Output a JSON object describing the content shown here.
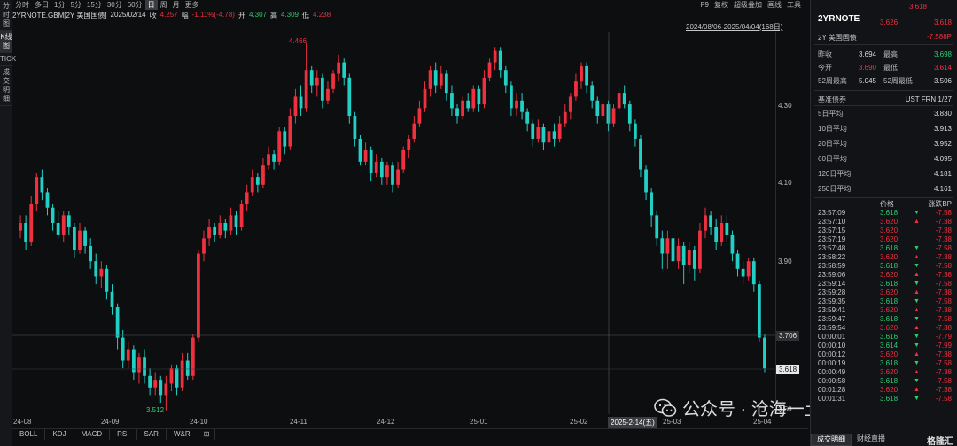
{
  "left_tabs": [
    "分时图",
    "K线图",
    "TICK",
    "成交明细"
  ],
  "left_tab_active": 1,
  "toolbar": {
    "periods": [
      "分时",
      "多日",
      "1分",
      "5分",
      "15分",
      "30分",
      "60分",
      "日",
      "周",
      "月",
      "更多"
    ],
    "active_period": 7,
    "right_items": [
      "F9",
      "复权",
      "超级叠加",
      "画线",
      "工具"
    ]
  },
  "info": {
    "symbol": "2YRNOTE.GBM[2Y 美国国债]",
    "date": "2025/02/14",
    "close_label": "收",
    "close": "4.257",
    "change_label": "幅",
    "change": "-1.11%(-4.78)",
    "open_label": "开",
    "open": "4.307",
    "high_label": "高",
    "high": "4.309",
    "low_label": "低",
    "low": "4.238"
  },
  "range_label": "2024/08/06-2025/04/04(168日)",
  "yaxis_ticks": [
    "4.30",
    "4.10",
    "3.90",
    "3.70",
    "3.50"
  ],
  "xaxis_ticks": [
    "24-08",
    "24-09",
    "24-10",
    "24-11",
    "24-12",
    "25-01",
    "25-02",
    "25-03",
    "25-04"
  ],
  "cursor_date": "2025-2-14(五)",
  "crosshair_price": "3.706",
  "last_price_tag": "3.618",
  "peak_high": "4.466",
  "trough_low": "3.512",
  "indicator_tabs": [
    "BOLL",
    "KDJ",
    "MACD",
    "RSI",
    "SAR",
    "W&R"
  ],
  "indicator_add": "⊞",
  "quote": {
    "symbol": "2YRNOTE",
    "name": "2Y 美国国债",
    "last_top": "3.618",
    "mid_a": "3.626",
    "mid_b": "3.618",
    "change_bp": "-7.588P",
    "stats": [
      {
        "l1": "昨收",
        "v1": "3.694",
        "c1": "white",
        "l2": "最高",
        "v2": "3.698",
        "c2": "green"
      },
      {
        "l1": "今开",
        "v1": "3.690",
        "c1": "up",
        "l2": "最低",
        "v2": "3.614",
        "c2": "up"
      },
      {
        "l1": "52周最高",
        "v1": "5.045",
        "c1": "white",
        "l2": "52周最低",
        "v2": "3.506",
        "c2": "white"
      }
    ],
    "benchmark_label": "基准债券",
    "benchmark_value": "UST FRN 1/27",
    "averages": [
      {
        "label": "5日平均",
        "value": "3.830"
      },
      {
        "label": "10日平均",
        "value": "3.913"
      },
      {
        "label": "20日平均",
        "value": "3.952"
      },
      {
        "label": "60日平均",
        "value": "4.095"
      },
      {
        "label": "120日平均",
        "value": "4.181"
      },
      {
        "label": "250日平均",
        "value": "4.161"
      }
    ],
    "trades_headers": [
      "价格",
      "涨跌BP"
    ],
    "trades": [
      {
        "t": "23:57:09",
        "p": "3.618",
        "d": "down",
        "bp": "-7.58"
      },
      {
        "t": "23:57:10",
        "p": "3.620",
        "d": "up",
        "bp": "-7.38"
      },
      {
        "t": "23:57:15",
        "p": "3.620",
        "d": "none",
        "bp": "-7.38"
      },
      {
        "t": "23:57:19",
        "p": "3.620",
        "d": "none",
        "bp": "-7.38"
      },
      {
        "t": "23:57:48",
        "p": "3.618",
        "d": "down",
        "bp": "-7.58"
      },
      {
        "t": "23:58:22",
        "p": "3.620",
        "d": "up",
        "bp": "-7.38"
      },
      {
        "t": "23:58:59",
        "p": "3.618",
        "d": "down",
        "bp": "-7.58"
      },
      {
        "t": "23:59:06",
        "p": "3.620",
        "d": "up",
        "bp": "-7.38"
      },
      {
        "t": "23:59:14",
        "p": "3.618",
        "d": "down",
        "bp": "-7.58"
      },
      {
        "t": "23:59:28",
        "p": "3.620",
        "d": "up",
        "bp": "-7.38"
      },
      {
        "t": "23:59:35",
        "p": "3.618",
        "d": "down",
        "bp": "-7.58"
      },
      {
        "t": "23:59:41",
        "p": "3.620",
        "d": "up",
        "bp": "-7.38"
      },
      {
        "t": "23:59:47",
        "p": "3.618",
        "d": "down",
        "bp": "-7.58"
      },
      {
        "t": "23:59:54",
        "p": "3.620",
        "d": "up",
        "bp": "-7.38"
      },
      {
        "t": "00:00:01",
        "p": "3.616",
        "d": "down",
        "bp": "-7.79"
      },
      {
        "t": "00:00:10",
        "p": "3.614",
        "d": "down",
        "bp": "-7.99"
      },
      {
        "t": "00:00:12",
        "p": "3.620",
        "d": "up",
        "bp": "-7.38"
      },
      {
        "t": "00:00:19",
        "p": "3.618",
        "d": "down",
        "bp": "-7.58"
      },
      {
        "t": "00:00:49",
        "p": "3.620",
        "d": "up",
        "bp": "-7.38"
      },
      {
        "t": "00:00:58",
        "p": "3.618",
        "d": "down",
        "bp": "-7.58"
      },
      {
        "t": "00:01:28",
        "p": "3.620",
        "d": "up",
        "bp": "-7.38"
      },
      {
        "t": "00:01:31",
        "p": "3.618",
        "d": "down",
        "bp": "-7.58"
      }
    ],
    "panel_tabs": [
      "成交明细",
      "财经直播"
    ],
    "panel_tab_active": 0,
    "brand": "格隆汇"
  },
  "watermark": "公众号 · 沧海一土狗",
  "colors": {
    "up": "#f0303e",
    "down": "#22cfc5",
    "green": "#2ecc71"
  },
  "chart_data": {
    "type": "candlestick",
    "ylim": [
      3.5,
      4.5
    ],
    "x_ticks": [
      "24-08",
      "24-09",
      "24-10",
      "24-11",
      "24-12",
      "25-01",
      "25-02",
      "25-03",
      "25-04"
    ],
    "candles": [
      [
        3.98,
        4.0,
        4.02,
        3.96
      ],
      [
        4.0,
        3.95,
        4.02,
        3.93
      ],
      [
        3.95,
        4.05,
        4.07,
        3.94
      ],
      [
        4.05,
        4.12,
        4.13,
        4.03
      ],
      [
        4.12,
        4.08,
        4.14,
        4.06
      ],
      [
        4.08,
        4.04,
        4.09,
        4.02
      ],
      [
        4.04,
        4.0,
        4.05,
        3.98
      ],
      [
        4.0,
        3.97,
        4.03,
        3.96
      ],
      [
        3.97,
        4.02,
        4.03,
        3.95
      ],
      [
        4.02,
        3.99,
        4.03,
        3.97
      ],
      [
        3.99,
        3.93,
        4.0,
        3.91
      ],
      [
        3.93,
        3.98,
        4.0,
        3.92
      ],
      [
        3.98,
        3.94,
        3.99,
        3.92
      ],
      [
        3.94,
        3.9,
        3.96,
        3.88
      ],
      [
        3.9,
        3.86,
        3.92,
        3.84
      ],
      [
        3.86,
        3.88,
        3.9,
        3.83
      ],
      [
        3.88,
        3.82,
        3.89,
        3.8
      ],
      [
        3.82,
        3.78,
        3.84,
        3.76
      ],
      [
        3.78,
        3.7,
        3.79,
        3.67
      ],
      [
        3.7,
        3.64,
        3.72,
        3.62
      ],
      [
        3.64,
        3.67,
        3.69,
        3.62
      ],
      [
        3.67,
        3.61,
        3.68,
        3.59
      ],
      [
        3.61,
        3.65,
        3.66,
        3.58
      ],
      [
        3.65,
        3.6,
        3.67,
        3.58
      ],
      [
        3.6,
        3.57,
        3.62,
        3.55
      ],
      [
        3.57,
        3.59,
        3.61,
        3.55
      ],
      [
        3.59,
        3.55,
        3.6,
        3.53
      ],
      [
        3.55,
        3.58,
        3.6,
        3.51
      ],
      [
        3.58,
        3.62,
        3.63,
        3.56
      ],
      [
        3.62,
        3.57,
        3.63,
        3.55
      ],
      [
        3.57,
        3.64,
        3.66,
        3.56
      ],
      [
        3.64,
        3.6,
        3.66,
        3.59
      ],
      [
        3.6,
        3.7,
        3.71,
        3.59
      ],
      [
        3.7,
        3.92,
        3.93,
        3.69
      ],
      [
        3.92,
        3.96,
        3.98,
        3.9
      ],
      [
        3.96,
        3.99,
        4.01,
        3.94
      ],
      [
        3.99,
        3.97,
        4.0,
        3.95
      ],
      [
        3.97,
        4.0,
        4.02,
        3.96
      ],
      [
        4.0,
        3.98,
        4.01,
        3.96
      ],
      [
        3.98,
        4.02,
        4.04,
        3.97
      ],
      [
        4.02,
        3.99,
        4.03,
        3.97
      ],
      [
        3.99,
        4.05,
        4.06,
        3.98
      ],
      [
        4.05,
        4.08,
        4.1,
        4.03
      ],
      [
        4.08,
        4.12,
        4.14,
        4.07
      ],
      [
        4.12,
        4.1,
        4.13,
        4.08
      ],
      [
        4.1,
        4.15,
        4.17,
        4.09
      ],
      [
        4.15,
        4.18,
        4.2,
        4.14
      ],
      [
        4.18,
        4.16,
        4.19,
        4.14
      ],
      [
        4.16,
        4.24,
        4.25,
        4.15
      ],
      [
        4.24,
        4.2,
        4.25,
        4.18
      ],
      [
        4.2,
        4.28,
        4.3,
        4.19
      ],
      [
        4.28,
        4.33,
        4.35,
        4.26
      ],
      [
        4.33,
        4.3,
        4.36,
        4.28
      ],
      [
        4.3,
        4.4,
        4.47,
        4.29
      ],
      [
        4.4,
        4.36,
        4.41,
        4.34
      ],
      [
        4.36,
        4.38,
        4.4,
        4.33
      ],
      [
        4.38,
        4.32,
        4.39,
        4.3
      ],
      [
        4.32,
        4.35,
        4.37,
        4.31
      ],
      [
        4.35,
        4.39,
        4.4,
        4.34
      ],
      [
        4.39,
        4.42,
        4.44,
        4.37
      ],
      [
        4.42,
        4.38,
        4.43,
        4.36
      ],
      [
        4.38,
        4.28,
        4.39,
        4.26
      ],
      [
        4.28,
        4.22,
        4.29,
        4.2
      ],
      [
        4.22,
        4.16,
        4.23,
        4.15
      ],
      [
        4.16,
        4.19,
        4.21,
        4.15
      ],
      [
        4.19,
        4.13,
        4.2,
        4.11
      ],
      [
        4.13,
        4.16,
        4.18,
        4.12
      ],
      [
        4.16,
        4.12,
        4.17,
        4.1
      ],
      [
        4.12,
        4.15,
        4.16,
        4.1
      ],
      [
        4.15,
        4.1,
        4.16,
        4.08
      ],
      [
        4.1,
        4.14,
        4.16,
        4.09
      ],
      [
        4.14,
        4.19,
        4.2,
        4.13
      ],
      [
        4.19,
        4.22,
        4.23,
        4.17
      ],
      [
        4.22,
        4.26,
        4.28,
        4.21
      ],
      [
        4.26,
        4.3,
        4.32,
        4.25
      ],
      [
        4.3,
        4.35,
        4.37,
        4.29
      ],
      [
        4.35,
        4.4,
        4.41,
        4.33
      ],
      [
        4.4,
        4.36,
        4.42,
        4.34
      ],
      [
        4.36,
        4.39,
        4.41,
        4.35
      ],
      [
        4.39,
        4.34,
        4.4,
        4.32
      ],
      [
        4.34,
        4.3,
        4.36,
        4.28
      ],
      [
        4.3,
        4.28,
        4.31,
        4.26
      ],
      [
        4.28,
        4.32,
        4.33,
        4.27
      ],
      [
        4.32,
        4.3,
        4.34,
        4.29
      ],
      [
        4.3,
        4.35,
        4.36,
        4.29
      ],
      [
        4.35,
        4.31,
        4.36,
        4.29
      ],
      [
        4.31,
        4.38,
        4.4,
        4.3
      ],
      [
        4.38,
        4.42,
        4.43,
        4.37
      ],
      [
        4.42,
        4.45,
        4.46,
        4.4
      ],
      [
        4.45,
        4.4,
        4.46,
        4.38
      ],
      [
        4.4,
        4.36,
        4.41,
        4.34
      ],
      [
        4.36,
        4.3,
        4.37,
        4.28
      ],
      [
        4.3,
        4.32,
        4.34,
        4.28
      ],
      [
        4.32,
        4.29,
        4.34,
        4.27
      ],
      [
        4.29,
        4.26,
        4.3,
        4.24
      ],
      [
        4.26,
        4.22,
        4.27,
        4.2
      ],
      [
        4.22,
        4.25,
        4.27,
        4.21
      ],
      [
        4.25,
        4.21,
        4.26,
        4.19
      ],
      [
        4.21,
        4.24,
        4.25,
        4.2
      ],
      [
        4.24,
        4.22,
        4.26,
        4.2
      ],
      [
        4.22,
        4.26,
        4.28,
        4.21
      ],
      [
        4.26,
        4.29,
        4.31,
        4.25
      ],
      [
        4.29,
        4.33,
        4.34,
        4.27
      ],
      [
        4.33,
        4.37,
        4.39,
        4.32
      ],
      [
        4.37,
        4.41,
        4.42,
        4.35
      ],
      [
        4.41,
        4.36,
        4.42,
        4.34
      ],
      [
        4.36,
        4.32,
        4.37,
        4.3
      ],
      [
        4.32,
        4.28,
        4.33,
        4.26
      ],
      [
        4.28,
        4.31,
        4.32,
        4.27
      ],
      [
        4.31,
        4.26,
        4.32,
        4.24
      ],
      [
        4.26,
        4.3,
        4.31,
        4.25
      ],
      [
        4.3,
        4.34,
        4.35,
        4.29
      ],
      [
        4.34,
        4.31,
        4.36,
        4.3
      ],
      [
        4.31,
        4.26,
        4.32,
        4.24
      ],
      [
        4.26,
        4.22,
        4.27,
        4.2
      ],
      [
        4.22,
        4.14,
        4.23,
        4.12
      ],
      [
        4.14,
        4.08,
        4.15,
        4.06
      ],
      [
        4.08,
        4.02,
        4.09,
        3.99
      ],
      [
        4.02,
        3.96,
        4.03,
        3.94
      ],
      [
        3.96,
        3.92,
        3.98,
        3.88
      ],
      [
        3.92,
        3.96,
        3.98,
        3.88
      ],
      [
        3.96,
        3.9,
        3.97,
        3.86
      ],
      [
        3.9,
        3.94,
        3.96,
        3.88
      ],
      [
        3.94,
        3.89,
        3.95,
        3.84
      ],
      [
        3.89,
        3.93,
        3.95,
        3.87
      ],
      [
        3.93,
        3.88,
        3.94,
        3.85
      ],
      [
        3.88,
        3.98,
        4.0,
        3.87
      ],
      [
        3.98,
        4.02,
        4.04,
        3.96
      ],
      [
        4.02,
        3.99,
        4.03,
        3.97
      ],
      [
        3.99,
        3.95,
        4.01,
        3.93
      ],
      [
        3.95,
        4.0,
        4.02,
        3.94
      ],
      [
        4.0,
        3.97,
        4.02,
        3.95
      ],
      [
        3.97,
        3.92,
        3.98,
        3.9
      ],
      [
        3.92,
        3.88,
        3.93,
        3.86
      ],
      [
        3.88,
        3.86,
        3.9,
        3.84
      ],
      [
        3.86,
        3.9,
        3.91,
        3.85
      ],
      [
        3.9,
        3.84,
        3.91,
        3.82
      ],
      [
        3.84,
        3.7,
        3.85,
        3.69
      ],
      [
        3.7,
        3.62,
        3.71,
        3.61
      ]
    ]
  }
}
